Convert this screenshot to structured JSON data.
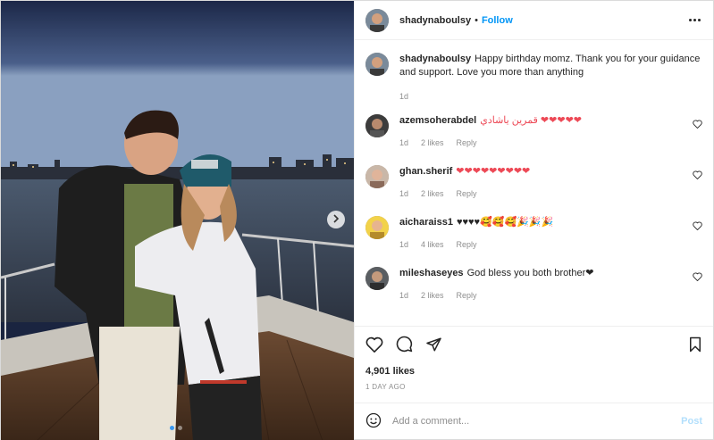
{
  "header": {
    "username": "shadynaboulsy",
    "separator": "•",
    "follow_label": "Follow"
  },
  "caption": {
    "username": "shadynaboulsy",
    "text": "Happy birthday momz. Thank you for your guidance and support. Love you more than anything",
    "age": "1d"
  },
  "comments": [
    {
      "username": "azemsoherabdel",
      "text": "قمرين ياشادي ❤❤❤❤❤",
      "age": "1d",
      "likes": "2 likes",
      "reply": "Reply"
    },
    {
      "username": "ghan.sherif",
      "text": "❤❤❤❤❤❤❤❤❤",
      "age": "1d",
      "likes": "2 likes",
      "reply": "Reply"
    },
    {
      "username": "aicharaiss1",
      "text": "♥♥♥♥🥰🥰🥰🎉🎉🎉",
      "age": "1d",
      "likes": "4 likes",
      "reply": "Reply"
    },
    {
      "username": "mileshaseyes",
      "text": "God bless you both brother❤",
      "age": "1d",
      "likes": "2 likes",
      "reply": "Reply"
    }
  ],
  "actions": {
    "likes": "4,901 likes",
    "date": "1 DAY AGO"
  },
  "add_comment": {
    "placeholder": "Add a comment...",
    "post_label": "Post"
  },
  "colors": {
    "link_blue": "#0095f6",
    "post_disabled": "#b2dffc",
    "heart_red": "#ed4956",
    "muted": "#8e8e8e"
  },
  "icons": [
    "chevron-right-icon",
    "more-options-icon",
    "heart-icon",
    "comment-icon",
    "share-icon",
    "bookmark-icon",
    "emoji-icon"
  ],
  "carousel": {
    "current": 1,
    "total": 2
  }
}
